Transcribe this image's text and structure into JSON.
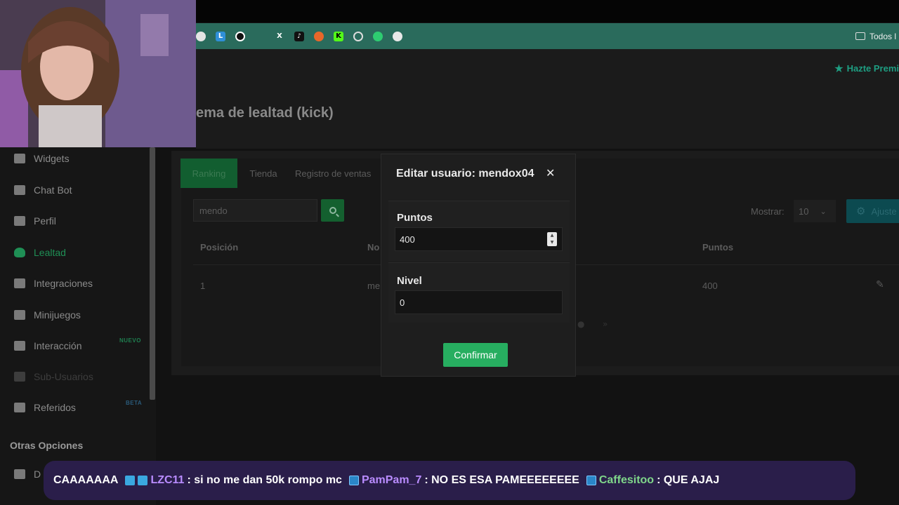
{
  "bookmarks": {
    "icons": [
      "reddit-icon",
      "l-icon",
      "circle-icon",
      "x-icon",
      "tiktok-icon",
      "orange-circle-icon",
      "kick-icon",
      "openai-icon",
      "green-h-icon",
      "globe-icon"
    ],
    "l_label": "L",
    "x_label": "X",
    "k_label": "K",
    "folder_label": "Todos l"
  },
  "header": {
    "title": "ema de lealtad (kick)",
    "premium": "Hazte Premi"
  },
  "sidebar": {
    "items": [
      {
        "label": "Widgets",
        "icon": "grid-icon"
      },
      {
        "label": "Chat Bot",
        "icon": "robot-icon"
      },
      {
        "label": "Perfil",
        "icon": "id-card-icon"
      },
      {
        "label": "Lealtad",
        "icon": "trophy-icon"
      },
      {
        "label": "Integraciones",
        "icon": "plug-icon"
      },
      {
        "label": "Minijuegos",
        "icon": "gamepad-icon"
      },
      {
        "label": "Interacción",
        "icon": "music-icon"
      },
      {
        "label": "Sub-Usuarios",
        "icon": "users-icon"
      },
      {
        "label": "Referidos",
        "icon": "referral-icon"
      }
    ],
    "tag_nuevo": "NUEVO",
    "tag_beta": "BETA",
    "section_title": "Otras Opciones",
    "partial_item": "D"
  },
  "tabs": [
    "Ranking",
    "Tienda",
    "Registro de ventas"
  ],
  "search": {
    "value": "mendo"
  },
  "mostrar": {
    "label": "Mostrar:",
    "value": "10"
  },
  "ajustes": {
    "label": "Ajuste"
  },
  "table": {
    "headers": {
      "posicion": "Posición",
      "nombre": "No",
      "puntos": "Puntos"
    },
    "rows": [
      {
        "posicion": "1",
        "nombre": "me",
        "puntos": "400"
      }
    ]
  },
  "modal": {
    "title": "Editar usuario: mendox04",
    "puntos_label": "Puntos",
    "puntos_value": "400",
    "nivel_label": "Nivel",
    "nivel_value": "0",
    "confirm_label": "Confirmar"
  },
  "ticker": {
    "messages": [
      {
        "user": "",
        "text": "CAAAAAAA",
        "user_color": "#ffffff"
      },
      {
        "user": "LZC11",
        "text": ": si no me dan 50k rompo mc",
        "user_color": "#b98cff"
      },
      {
        "user": "PamPam_7",
        "text": ": NO ES ESA PAMEEEEEEEE",
        "user_color": "#b98cff"
      },
      {
        "user": "Caffesitoo",
        "text": ": QUE AJAJ",
        "user_color": "#7fd68a"
      }
    ]
  },
  "colors": {
    "accent_green": "#27ae60",
    "bookmark_bar": "#2a6b5c",
    "ticker_bg": "#2a1e4a"
  }
}
